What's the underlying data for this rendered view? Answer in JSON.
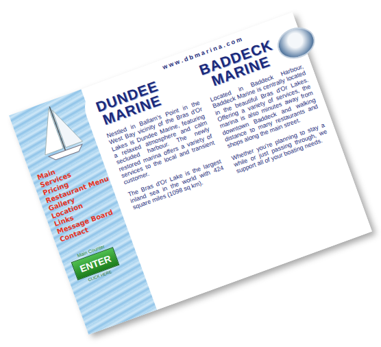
{
  "url": "w w w . d b m a r i n a . c o m",
  "menu": [
    "Main",
    "Services",
    "Pricing",
    "Restaurant Menu",
    "Gallery",
    "Location",
    "Links",
    "Message Board",
    "Contact"
  ],
  "counter": {
    "label": "Main Counter",
    "button": "ENTER",
    "hint": "CLICK HERE"
  },
  "columns": [
    {
      "logo": [
        "DUNDEE",
        "MARINE"
      ],
      "paragraphs": [
        "Nestled in Ballam's Point in the West Bay vicinity of the Bras d'Or Lakes is Dundee Marine, featuring a relaxed atmosphere and calm secluded harbour. The newly restored marina offers a variety of services to the local and transient customer.",
        "The Bras d'Or Lake is the largest inland sea in the world with 424 square miles (1098 sq km)."
      ]
    },
    {
      "logo": [
        "BADDECK",
        "MARINE"
      ],
      "paragraphs": [
        "Located in Baddeck Harbour, Baddeck Marine is centrally located in the beautiful Bras d'Or Lakes. Offering a variety of services, the marina is also minutes away from downtown Baddeck and walking distance to many restaurants and shops along the main street.",
        "Whether you're planning to stay a while or just passing through, we support all of your boating needs."
      ]
    }
  ]
}
